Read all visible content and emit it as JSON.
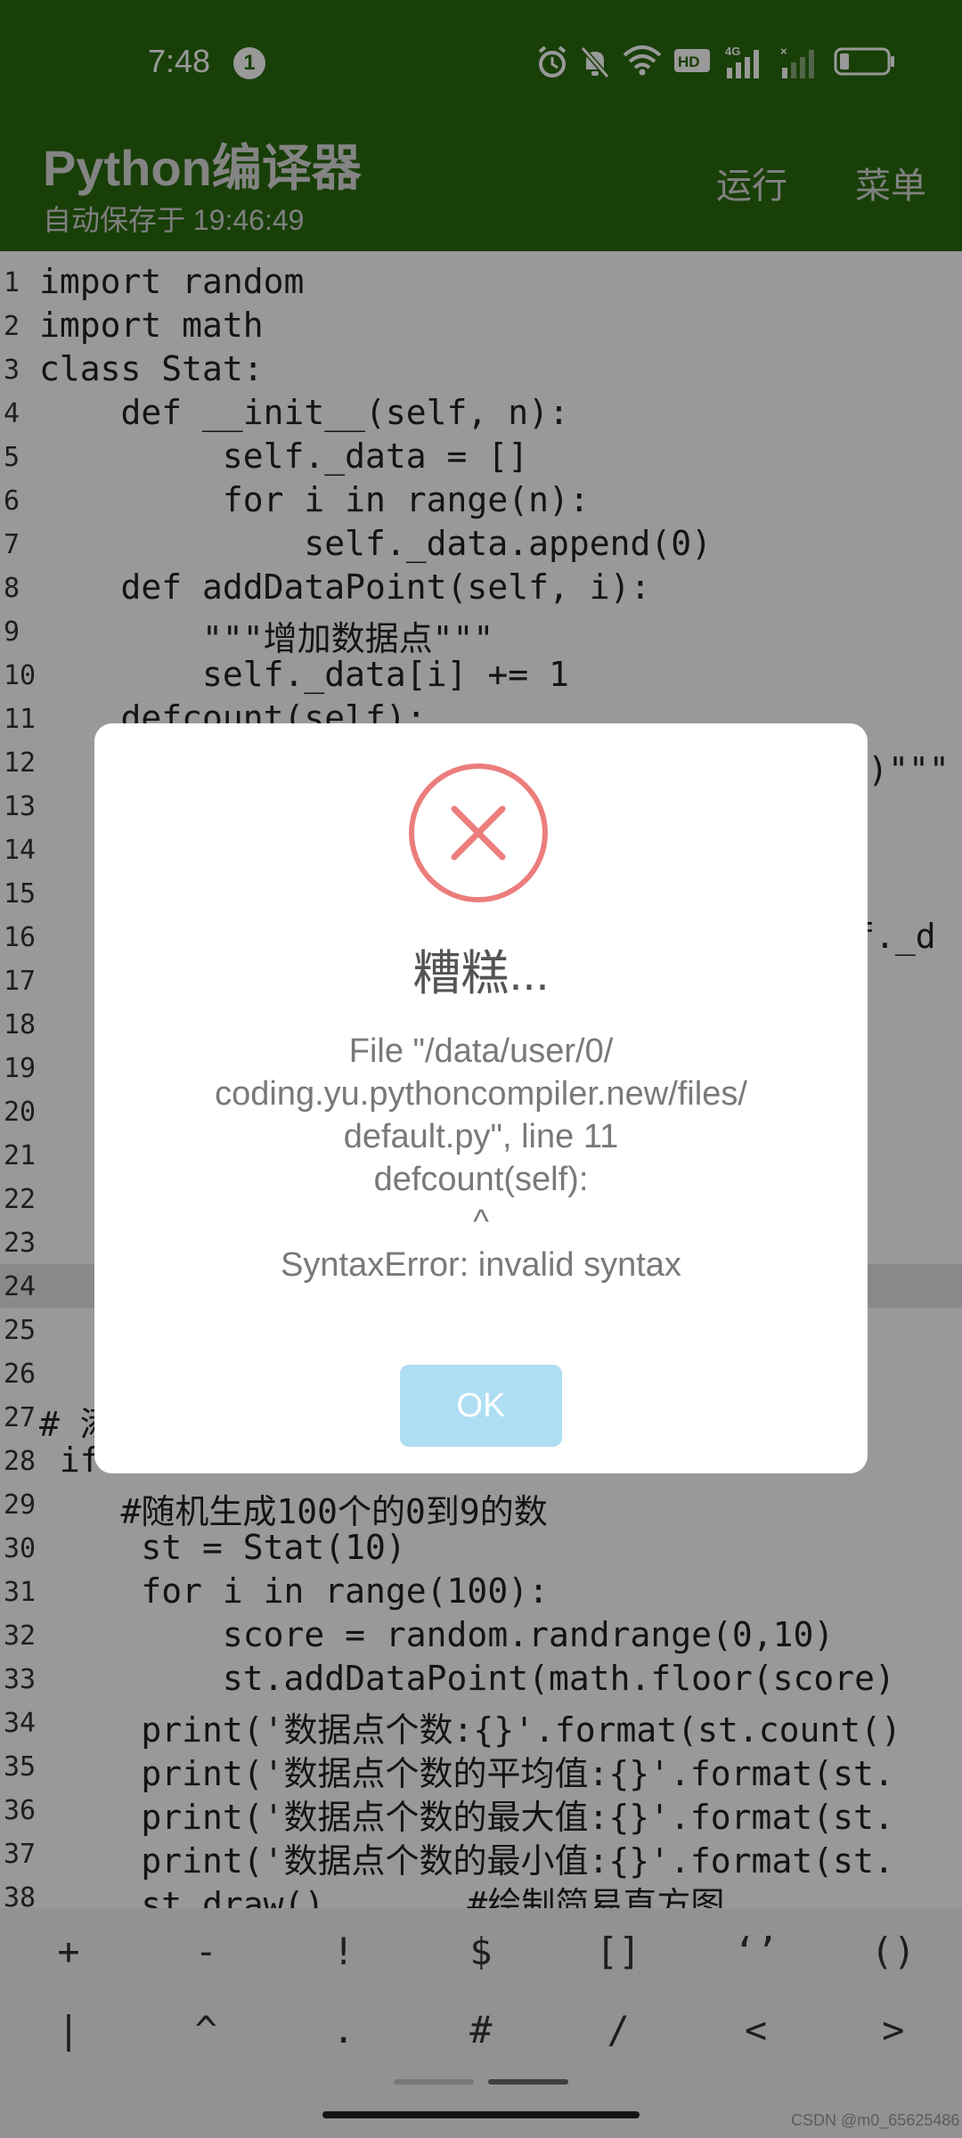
{
  "status_bar": {
    "time": "7:48",
    "notification_count": "1",
    "icons": [
      "alarm-icon",
      "mute-icon",
      "wifi-icon",
      "hd-icon",
      "signal-4g-icon",
      "signal-icon",
      "battery-icon"
    ]
  },
  "app_bar": {
    "title": "Python编译器",
    "subtitle": "自动保存于 19:46:49",
    "run_label": "运行",
    "menu_label": "菜单",
    "color": "#2a6a0e"
  },
  "editor": {
    "highlighted_line": 24,
    "lines": [
      {
        "n": "1",
        "t": "import random"
      },
      {
        "n": "2",
        "t": "import math"
      },
      {
        "n": "3",
        "t": "class Stat:"
      },
      {
        "n": "4",
        "t": "    def __init__(self, n):"
      },
      {
        "n": "5",
        "t": "         self._data = []"
      },
      {
        "n": "6",
        "t": "         for i in range(n):"
      },
      {
        "n": "7",
        "t": "             self._data.append(0)"
      },
      {
        "n": "8",
        "t": "    def addDataPoint(self, i):"
      },
      {
        "n": "9",
        "t": "        \"\"\"增加数据点\"\"\""
      },
      {
        "n": "10",
        "t": "        self._data[i] += 1"
      },
      {
        "n": "11",
        "t": "    defcount(self):"
      },
      {
        "n": "12",
        "t": "                                       数)\"\"\""
      },
      {
        "n": "13",
        "t": ""
      },
      {
        "n": "14",
        "t": ""
      },
      {
        "n": "15",
        "t": ""
      },
      {
        "n": "16",
        "t": "                                       lf._d"
      },
      {
        "n": "17",
        "t": ""
      },
      {
        "n": "18",
        "t": ""
      },
      {
        "n": "19",
        "t": ""
      },
      {
        "n": "20",
        "t": ""
      },
      {
        "n": "21",
        "t": ""
      },
      {
        "n": "22",
        "t": ""
      },
      {
        "n": "23",
        "t": ""
      },
      {
        "n": "24",
        "t": ""
      },
      {
        "n": "25",
        "t": ""
      },
      {
        "n": "26",
        "t": ""
      },
      {
        "n": "27",
        "t": "# 添"
      },
      {
        "n": "28",
        "t": " if"
      },
      {
        "n": "29",
        "t": "    #随机生成100个的0到9的数"
      },
      {
        "n": "30",
        "t": "     st = Stat(10)"
      },
      {
        "n": "31",
        "t": "     for i in range(100):"
      },
      {
        "n": "32",
        "t": "         score = random.randrange(0,10)"
      },
      {
        "n": "33",
        "t": "         st.addDataPoint(math.floor(score)"
      },
      {
        "n": "34",
        "t": "     print('数据点个数:{}'.format(st.count()"
      },
      {
        "n": "35",
        "t": "     print('数据点个数的平均值:{}'.format(st."
      },
      {
        "n": "36",
        "t": "     print('数据点个数的最大值:{}'.format(st."
      },
      {
        "n": "37",
        "t": "     print('数据点个数的最小值:{}'.format(st."
      },
      {
        "n": "38",
        "t": "     st.draw()       #绘制简易直方图"
      }
    ]
  },
  "symbols": {
    "row1": [
      "+",
      "-",
      "!",
      "$",
      "[]",
      "‘’",
      "()"
    ],
    "row2": [
      "|",
      "^",
      ".",
      "#",
      "/",
      "<",
      ">"
    ]
  },
  "dialog": {
    "title": "糟糕...",
    "message": "File \"/data/user/0/\ncoding.yu.pythoncompiler.new/files/\ndefault.py\", line 11\n    defcount(self):\n           ^\nSyntaxError: invalid syntax",
    "ok_label": "OK",
    "error_color": "#ec7d7d",
    "ok_color": "#aedef4"
  },
  "watermark": "CSDN @m0_65625486"
}
